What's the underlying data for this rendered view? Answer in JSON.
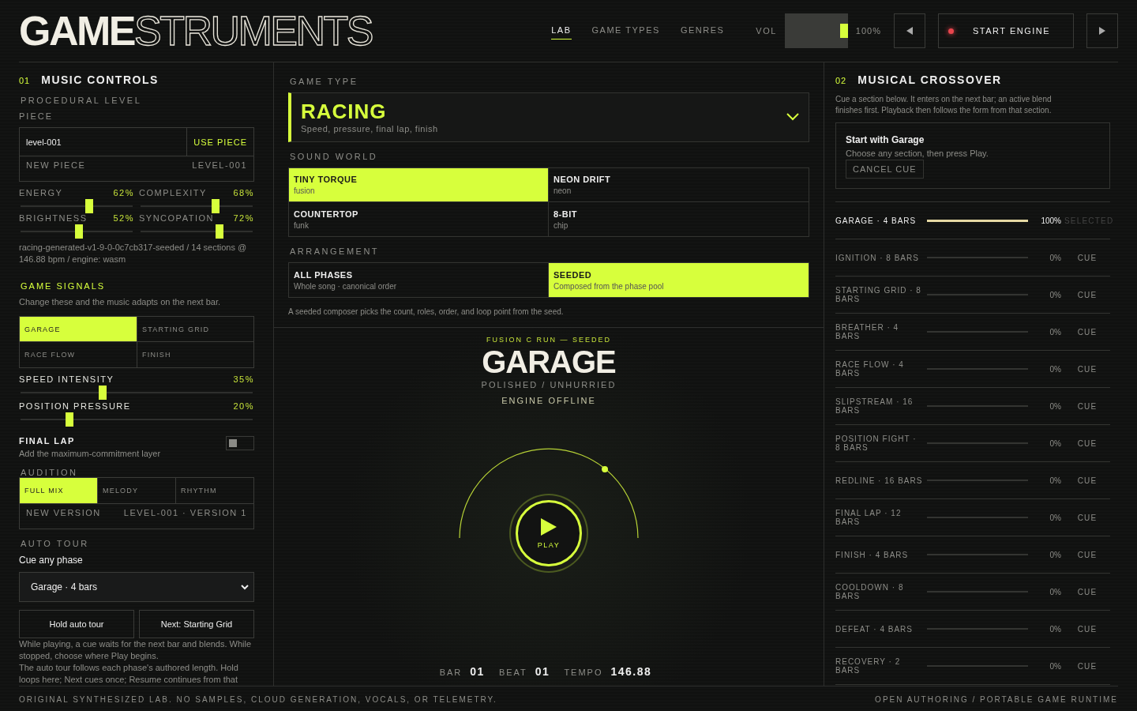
{
  "header": {
    "logo_bold": "GAME",
    "logo_outline": "STRUMENTS",
    "nav": [
      {
        "label": "LAB",
        "selected": true
      },
      {
        "label": "GAME TYPES",
        "selected": false
      },
      {
        "label": "GENRES",
        "selected": false
      }
    ],
    "volume": {
      "label": "VOL",
      "level": 1,
      "reading": "100%"
    },
    "engine": {
      "label": "START ENGINE",
      "running": false
    }
  },
  "music_controls": {
    "number": "01",
    "title": "MUSIC CONTROLS",
    "subtitle": "PROCEDURAL LEVEL",
    "piece": {
      "label": "PIECE",
      "value": "level-001",
      "action": "USE PIECE",
      "new_label": "NEW PIECE",
      "current": "LEVEL-001"
    },
    "sliders": [
      {
        "label": "ENERGY",
        "reading": "62%",
        "level": 0.62
      },
      {
        "label": "COMPLEXITY",
        "reading": "68%",
        "level": 0.68
      },
      {
        "label": "BRIGHTNESS",
        "reading": "52%",
        "level": 0.52
      },
      {
        "label": "SYNCOPATION",
        "reading": "72%",
        "level": 0.72
      }
    ],
    "engine_info": "racing-generated-v1-9-0-0c7cb317-seeded / 14 sections @ 146.88 bpm / engine: wasm"
  },
  "game_signals": {
    "title": "GAME SIGNALS",
    "description": "Change these and the music adapts on the next bar.",
    "phases": [
      {
        "label": "GARAGE",
        "selected": true
      },
      {
        "label": "STARTING GRID",
        "selected": false
      },
      {
        "label": "RACE FLOW",
        "selected": false
      },
      {
        "label": "FINISH",
        "selected": false
      }
    ],
    "sliders": [
      {
        "label": "SPEED INTENSITY",
        "reading": "35%",
        "level": 0.35
      },
      {
        "label": "POSITION PRESSURE",
        "reading": "20%",
        "level": 0.2
      }
    ],
    "final_lap": {
      "title": "FINAL LAP",
      "description": "Add the maximum-commitment layer",
      "on": false
    }
  },
  "audition": {
    "title": "AUDITION",
    "options": [
      {
        "label": "FULL MIX",
        "selected": true
      },
      {
        "label": "MELODY",
        "selected": false
      },
      {
        "label": "RHYTHM",
        "selected": false
      }
    ],
    "new_label": "NEW VERSION",
    "current": "LEVEL-001 · VERSION 1"
  },
  "auto_tour": {
    "title": "AUTO TOUR",
    "label": "Cue any phase",
    "select_value": "Garage · 4 bars",
    "buttons": [
      "Hold auto tour",
      "Next: Starting Grid"
    ],
    "notes": [
      "While playing, a cue waits for the next bar and blends. While stopped, choose where Play begins.",
      "The auto tour follows each phase's authored length. Hold loops here; Next cues once; Resume continues from that"
    ]
  },
  "game_type": {
    "label": "GAME TYPE",
    "value": "RACING",
    "description": "Speed, pressure, final lap, finish"
  },
  "sound_world": {
    "label": "SOUND WORLD",
    "options": [
      {
        "name": "TINY TORQUE",
        "style": "fusion",
        "selected": true
      },
      {
        "name": "NEON DRIFT",
        "style": "neon",
        "selected": false
      },
      {
        "name": "COUNTERTOP",
        "style": "funk",
        "selected": false
      },
      {
        "name": "8-BIT",
        "style": "chip",
        "selected": false
      }
    ]
  },
  "arrangement": {
    "label": "ARRANGEMENT",
    "options": [
      {
        "name": "ALL PHASES",
        "description": "Whole song · canonical order",
        "selected": false
      },
      {
        "name": "SEEDED",
        "description": "Composed from the phase pool",
        "selected": true
      }
    ],
    "note": "A seeded composer picks the count, roles, order, and loop point from the seed."
  },
  "now_playing": {
    "run": "FUSION C RUN — SEEDED",
    "section": "GARAGE",
    "mood": "POLISHED / UNHURRIED",
    "status": "ENGINE OFFLINE",
    "play_label": "PLAY",
    "counters": [
      {
        "label": "BAR",
        "value": "01"
      },
      {
        "label": "BEAT",
        "value": "01"
      },
      {
        "label": "TEMPO",
        "value": "146.88"
      }
    ]
  },
  "crossover": {
    "number": "02",
    "title": "MUSICAL CROSSOVER",
    "description": "Cue a section below. It enters on the next bar; an active blend finishes first. Playback then follows the form from that section.",
    "cue_card": {
      "title": "Start with Garage",
      "description": "Choose any section, then press Play.",
      "button": "CANCEL CUE"
    },
    "sections": [
      {
        "name": "GARAGE · 4 BARS",
        "level": 1,
        "reading": "100%",
        "action": "SELECTED",
        "selected": true
      },
      {
        "name": "IGNITION · 8 BARS",
        "level": 0,
        "reading": "0%",
        "action": "CUE",
        "selected": false
      },
      {
        "name": "STARTING GRID · 8 BARS",
        "level": 0,
        "reading": "0%",
        "action": "CUE",
        "selected": false
      },
      {
        "name": "BREATHER · 4 BARS",
        "level": 0,
        "reading": "0%",
        "action": "CUE",
        "selected": false
      },
      {
        "name": "RACE FLOW · 4 BARS",
        "level": 0,
        "reading": "0%",
        "action": "CUE",
        "selected": false
      },
      {
        "name": "SLIPSTREAM · 16 BARS",
        "level": 0,
        "reading": "0%",
        "action": "CUE",
        "selected": false
      },
      {
        "name": "POSITION FIGHT · 8 BARS",
        "level": 0,
        "reading": "0%",
        "action": "CUE",
        "selected": false
      },
      {
        "name": "REDLINE · 16 BARS",
        "level": 0,
        "reading": "0%",
        "action": "CUE",
        "selected": false
      },
      {
        "name": "FINAL LAP · 12 BARS",
        "level": 0,
        "reading": "0%",
        "action": "CUE",
        "selected": false
      },
      {
        "name": "FINISH · 4 BARS",
        "level": 0,
        "reading": "0%",
        "action": "CUE",
        "selected": false
      },
      {
        "name": "COOLDOWN · 8 BARS",
        "level": 0,
        "reading": "0%",
        "action": "CUE",
        "selected": false
      },
      {
        "name": "DEFEAT · 4 BARS",
        "level": 0,
        "reading": "0%",
        "action": "CUE",
        "selected": false
      },
      {
        "name": "RECOVERY · 2 BARS",
        "level": 0,
        "reading": "0%",
        "action": "CUE",
        "selected": false
      }
    ]
  },
  "footer": {
    "left": "ORIGINAL SYNTHESIZED LAB. NO SAMPLES, CLOUD GENERATION, VOCALS, OR TELEMETRY.",
    "right": "OPEN AUTHORING / PORTABLE GAME RUNTIME"
  }
}
